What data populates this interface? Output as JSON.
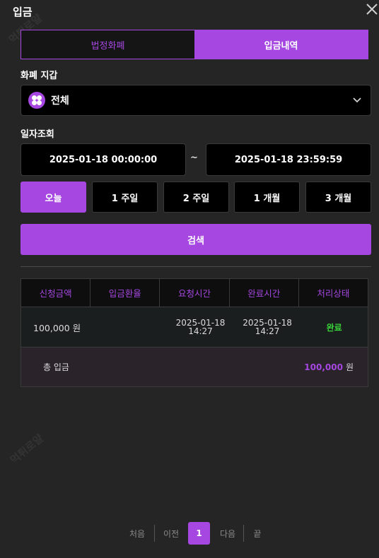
{
  "window": {
    "title": "입금"
  },
  "watermark": "먹튀로얄",
  "tabs": [
    {
      "label": "법정화폐",
      "active": false
    },
    {
      "label": "입금내역",
      "active": true
    }
  ],
  "wallet": {
    "label": "화폐 지갑",
    "selected": "전체"
  },
  "date_filter": {
    "label": "일자조회",
    "start": "2025-01-18 00:00:00",
    "separator": "~",
    "end": "2025-01-18 23:59:59"
  },
  "periods": [
    {
      "label": "오늘",
      "active": true
    },
    {
      "label": "1 주일",
      "active": false
    },
    {
      "label": "2 주일",
      "active": false
    },
    {
      "label": "1 개월",
      "active": false
    },
    {
      "label": "3 개월",
      "active": false
    }
  ],
  "search_label": "검색",
  "table": {
    "headers": [
      "신청금액",
      "입금환율",
      "요청시간",
      "완료시간",
      "처리상태"
    ],
    "rows": [
      {
        "amount": "100,000 원",
        "rate": "",
        "request_date": "2025-01-18",
        "request_time": "14:27",
        "complete_date": "2025-01-18",
        "complete_time": "14:27",
        "status": "완료"
      }
    ],
    "footer": {
      "label": "총 입금",
      "value": "100,000",
      "unit": "원"
    }
  },
  "pagination": {
    "first": "처음",
    "prev": "이전",
    "current": "1",
    "next": "다음",
    "last": "끝"
  },
  "colors": {
    "accent": "#a547e0",
    "success": "#39d63a",
    "background": "#252525"
  }
}
